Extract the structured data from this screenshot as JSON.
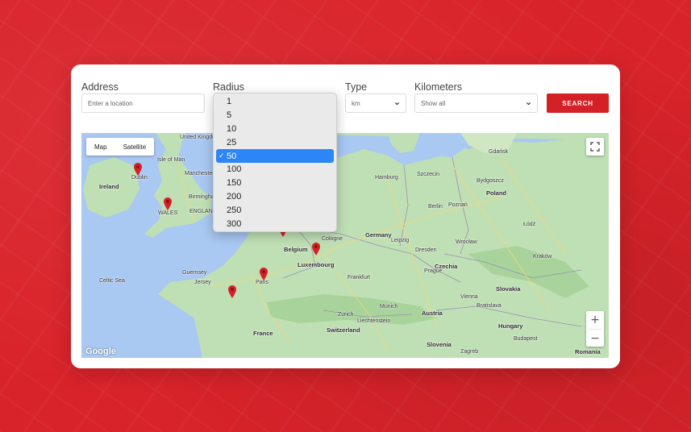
{
  "form": {
    "address": {
      "label": "Address",
      "placeholder": "Enter a location"
    },
    "radius": {
      "label": "Radius",
      "options": [
        "1",
        "5",
        "10",
        "25",
        "50",
        "100",
        "150",
        "200",
        "250",
        "300"
      ],
      "selected": "50",
      "check_glyph": "✓"
    },
    "type": {
      "label": "Type",
      "value": "km"
    },
    "kilometers": {
      "label": "Kilometers",
      "value": "Show all"
    },
    "search_label": "SEARCH"
  },
  "map": {
    "type_buttons": [
      "Map",
      "Satellite"
    ],
    "zoom_in": "+",
    "zoom_out": "−",
    "attribution": "Google",
    "places": [
      {
        "name": "Isle of Man",
        "kind": "city"
      },
      {
        "name": "United Kingdom",
        "kind": "country"
      },
      {
        "name": "Dublin",
        "kind": "city"
      },
      {
        "name": "Ireland",
        "kind": "country"
      },
      {
        "name": "Manchester",
        "kind": "city"
      },
      {
        "name": "Birmingham",
        "kind": "city"
      },
      {
        "name": "WALES",
        "kind": "city"
      },
      {
        "name": "ENGLAND",
        "kind": "city"
      },
      {
        "name": "Celtic Sea",
        "kind": "city"
      },
      {
        "name": "Guernsey",
        "kind": "city"
      },
      {
        "name": "Jersey",
        "kind": "city"
      },
      {
        "name": "Paris",
        "kind": "city"
      },
      {
        "name": "France",
        "kind": "country"
      },
      {
        "name": "Belgium",
        "kind": "country"
      },
      {
        "name": "Luxembourg",
        "kind": "country"
      },
      {
        "name": "Germany",
        "kind": "country"
      },
      {
        "name": "Czechia",
        "kind": "country"
      },
      {
        "name": "Austria",
        "kind": "country"
      },
      {
        "name": "Switzerland",
        "kind": "country"
      },
      {
        "name": "Liechtenstein",
        "kind": "city"
      },
      {
        "name": "Slovenia",
        "kind": "country"
      },
      {
        "name": "Hungary",
        "kind": "country"
      },
      {
        "name": "Slovakia",
        "kind": "country"
      },
      {
        "name": "Poland",
        "kind": "country"
      },
      {
        "name": "Romania",
        "kind": "country"
      },
      {
        "name": "Gdańsk",
        "kind": "city"
      },
      {
        "name": "Szczecin",
        "kind": "city"
      },
      {
        "name": "Bydgoszcz",
        "kind": "city"
      },
      {
        "name": "Poznań",
        "kind": "city"
      },
      {
        "name": "Łódź",
        "kind": "city"
      },
      {
        "name": "Wrocław",
        "kind": "city"
      },
      {
        "name": "Kraków",
        "kind": "city"
      },
      {
        "name": "Vienna",
        "kind": "city"
      },
      {
        "name": "Bratislava",
        "kind": "city"
      },
      {
        "name": "Budapest",
        "kind": "city"
      },
      {
        "name": "Munich",
        "kind": "city"
      },
      {
        "name": "Prague",
        "kind": "city"
      },
      {
        "name": "Dresden",
        "kind": "city"
      },
      {
        "name": "Leipzig",
        "kind": "city"
      },
      {
        "name": "Cologne",
        "kind": "city"
      },
      {
        "name": "Frankfurt",
        "kind": "city"
      },
      {
        "name": "Hamburg",
        "kind": "city"
      },
      {
        "name": "Berlin",
        "kind": "city"
      },
      {
        "name": "Zurich",
        "kind": "city"
      },
      {
        "name": "Zagreb",
        "kind": "city"
      }
    ],
    "pins": 6
  },
  "colors": {
    "brand_red": "#d42027",
    "selected_option": "#2d86f7",
    "water": "#a9c8f2",
    "land": "#bfe0b4"
  }
}
